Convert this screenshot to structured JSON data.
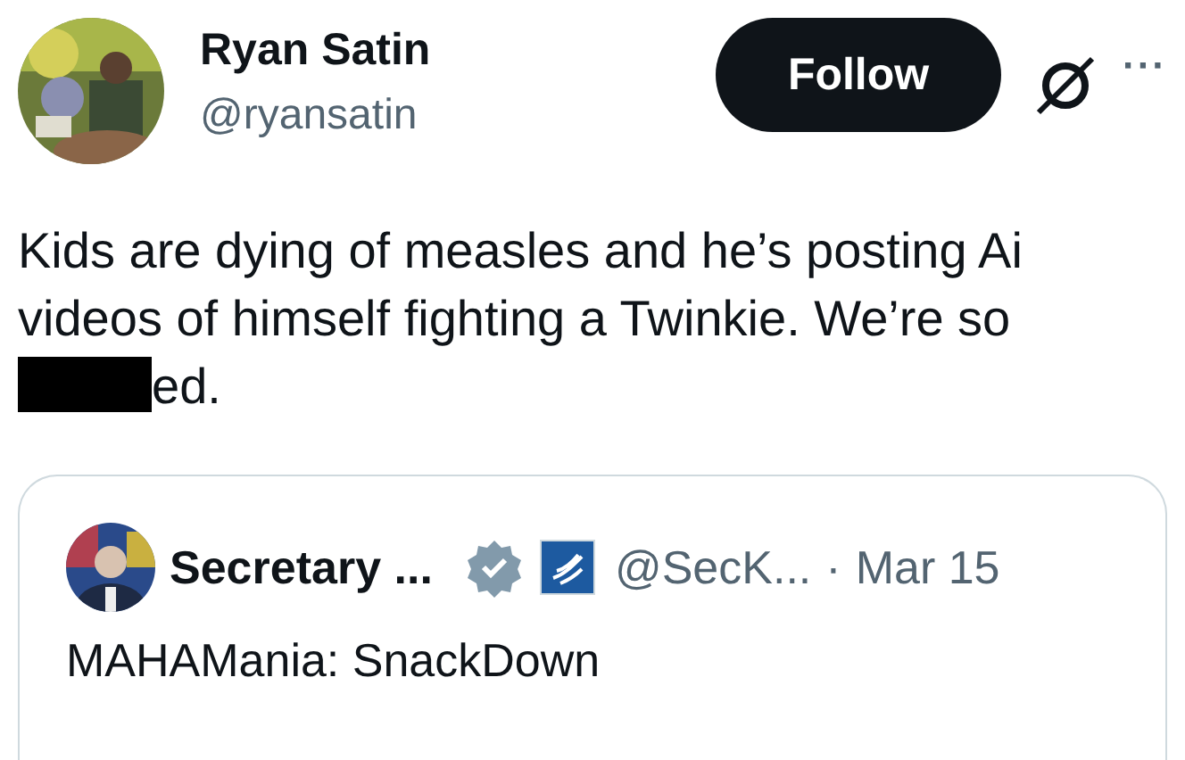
{
  "author": {
    "name": "Ryan Satin",
    "handle": "@ryansatin"
  },
  "follow_button": {
    "label": "Follow"
  },
  "more_button": {
    "label": "···"
  },
  "post": {
    "text_before": "Kids are dying of measles and he’s posting Ai videos of himself fighting a Twinkie. We’re so",
    "redacted": true,
    "text_after": "ed."
  },
  "quoted_post": {
    "name": "Secretary ...",
    "verified": true,
    "handle": "@SecK...",
    "separator": "·",
    "date": "Mar 15",
    "text": "MAHAMania: SnackDown"
  }
}
